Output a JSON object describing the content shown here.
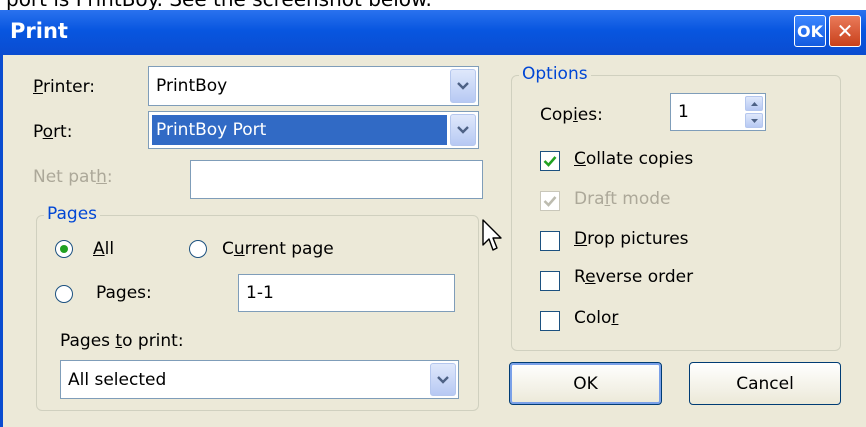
{
  "caption": "port is PrintBoy. See the screenshot below.",
  "window": {
    "title": "Print",
    "ok_label": "OK",
    "close_glyph": "✕"
  },
  "printer": {
    "label_underline": "P",
    "label_rest": "rinter:",
    "value": "PrintBoy"
  },
  "port": {
    "label_start": "P",
    "label_underline": "o",
    "label_rest": "rt:",
    "value": "PrintBoy Port"
  },
  "net_path": {
    "label_start": "Net pat",
    "label_underline": "h",
    "label_rest": ":",
    "value": ""
  },
  "pages_group": {
    "title": "Pages",
    "all": {
      "underline": "A",
      "rest": "ll",
      "selected": true
    },
    "current_page": {
      "start": "C",
      "underline": "u",
      "rest": "rrent page",
      "selected": false
    },
    "pages": {
      "label": "Pages:",
      "selected": false,
      "range_value": "1-1"
    },
    "pages_to_print": {
      "start": "Pages ",
      "underline": "t",
      "rest": "o print:",
      "value": "All selected"
    }
  },
  "options_group": {
    "title": "Options",
    "copies": {
      "start": "Cop",
      "underline": "i",
      "rest": "es:",
      "value": "1"
    },
    "collate": {
      "underline": "C",
      "rest": "ollate copies",
      "checked": true,
      "enabled": true
    },
    "draft": {
      "start": "Dra",
      "underline": "f",
      "rest": "t mode",
      "checked": true,
      "enabled": false
    },
    "drop": {
      "underline": "D",
      "rest": "rop pictures",
      "checked": false,
      "enabled": true
    },
    "reverse": {
      "start": "R",
      "underline": "e",
      "rest": "verse order",
      "checked": false,
      "enabled": true
    },
    "color": {
      "start": "Colo",
      "underline": "r",
      "rest": "",
      "checked": false,
      "enabled": true
    }
  },
  "buttons": {
    "ok": "OK",
    "cancel": "Cancel"
  },
  "colors": {
    "title_bar": "#0a4cd0",
    "dialog_bg": "#ece9d8",
    "group_title": "#0046d5",
    "radio_dot": "#21a121",
    "check_mark": "#21a121"
  },
  "icons": {
    "dropdown": "chevron-down-icon",
    "spin_up": "spin-up-icon",
    "spin_down": "spin-down-icon",
    "cursor": "mouse-cursor-icon"
  }
}
